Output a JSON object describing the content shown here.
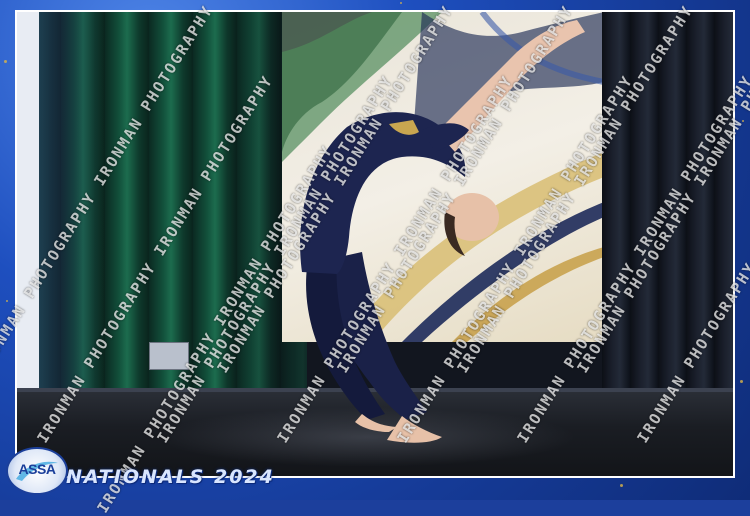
{
  "branding": {
    "logo_text": "ASSA",
    "event_title": "NATIONALS 2024",
    "watermark_text": "IRONMAN PHOTOGRAPHY"
  },
  "colors": {
    "frame_blue": "#1e4fbf",
    "curtain_green": "#1c6c4e",
    "costume_navy": "#1a2148",
    "stage_floor": "#1a1d23"
  },
  "watermark_lines": [
    "IRONMAN PHOTOGRAPHY IRONMAN PHOTOGRAPHY",
    "IRONMAN PHOTOGRAPHY IRONMAN PHOTOGRAPHY",
    "IRONMAN PHOTOGRAPHY IRONMAN PHOTOGRAPHY",
    "IRONMAN PHOTOGRAPHY IRONMAN PHOTOGRAPHY",
    "IRONMAN PHOTOGRAPHY IRONMAN PHOTOGRAPHY",
    "IRONMAN PHOTOGRAPHY IRONMAN PHOTOGRAPHY",
    "IRONMAN PHOTOGRAPHY IRONMAN PHOTOGRAPHY",
    "IRONMAN PHOTOGRAPHY IRONMAN PHOTOGRAPHY",
    "IRONMAN PHOTOGRAPHY IRONMAN PHOTOGRAPHY",
    "IRONMAN PHOTOGRAPHY IRONMAN PHOTOGRAPHY",
    "IRONMAN PHOTOGRAPHY IRONMAN PHOTOGRAPHY",
    "IRONMAN PHOTOGRAPHY IRONMAN PHOTOGRAPHY"
  ]
}
